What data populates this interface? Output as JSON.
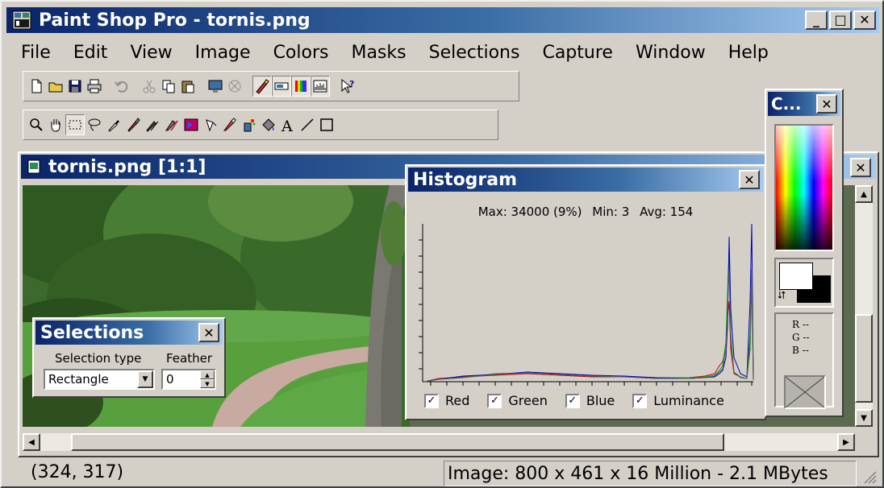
{
  "window": {
    "title": "Paint Shop Pro - tornis.png",
    "minimize": "_",
    "maximize": "□",
    "close": "✕"
  },
  "menu": [
    "File",
    "Edit",
    "View",
    "Image",
    "Colors",
    "Masks",
    "Selections",
    "Capture",
    "Window",
    "Help"
  ],
  "document": {
    "title": "tornis.png [1:1]",
    "close": "✕"
  },
  "selections_palette": {
    "title": "Selections",
    "close": "✕",
    "type_label": "Selection type",
    "type_value": "Rectangle",
    "feather_label": "Feather",
    "feather_value": "0"
  },
  "histogram": {
    "title": "Histogram",
    "close": "✕",
    "max": "Max: 34000 (9%)",
    "min": "Min: 3",
    "avg": "Avg: 154",
    "checks": [
      {
        "label": "Red",
        "checked": true
      },
      {
        "label": "Green",
        "checked": true
      },
      {
        "label": "Blue",
        "checked": true
      },
      {
        "label": "Luminance",
        "checked": true
      }
    ]
  },
  "colors_palette": {
    "title": "C...",
    "close": "✕",
    "r": "R --",
    "g": "G --",
    "b": "B --"
  },
  "status": {
    "coords": "(324, 317)",
    "info": "Image:  800 x 461 x 16 Million - 2.1 MBytes"
  }
}
